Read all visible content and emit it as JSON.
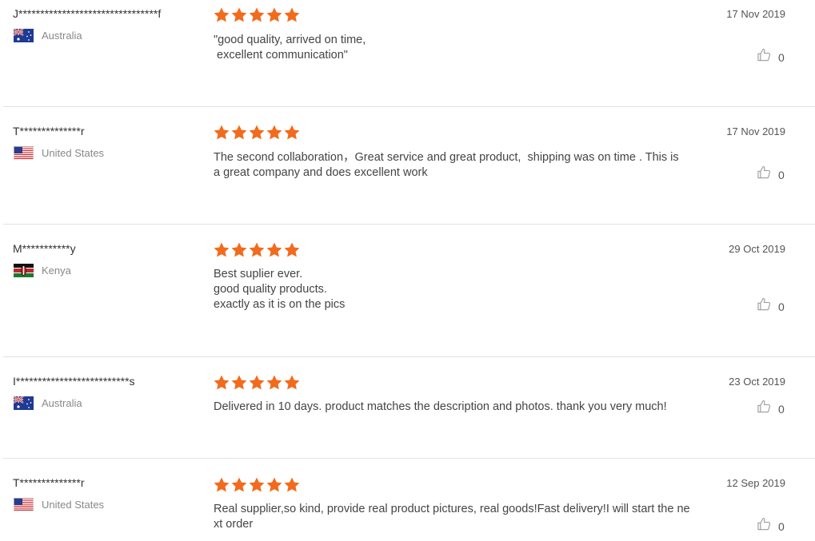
{
  "reviews": [
    {
      "name": "J********************************f",
      "country": "Australia",
      "flag": "australia-flag-icon",
      "rating": 5,
      "text_lines": [
        "\"good quality, arrived on time,",
        " excellent communication\""
      ],
      "date": "17 Nov 2019",
      "likes": "0"
    },
    {
      "name": "T**************r",
      "country": "United States",
      "flag": "us-flag-icon",
      "rating": 5,
      "text_lines": [
        "The second collaboration，Great service and great product,  shipping was on time . This is",
        "a great company and does excellent work"
      ],
      "date": "17 Nov 2019",
      "likes": "0"
    },
    {
      "name": "M***********y",
      "country": "Kenya",
      "flag": "kenya-flag-icon",
      "rating": 5,
      "text_lines": [
        "Best suplier ever.",
        "good quality products.",
        "exactly as it is on the pics"
      ],
      "date": "29 Oct 2019",
      "likes": "0"
    },
    {
      "name": "I**************************s",
      "country": "Australia",
      "flag": "australia-flag-icon",
      "rating": 5,
      "text_lines": [
        "Delivered in 10 days. product matches the description and photos. thank you very much!"
      ],
      "date": "23 Oct 2019",
      "likes": "0"
    },
    {
      "name": "T**************r",
      "country": "United States",
      "flag": "us-flag-icon",
      "rating": 5,
      "text_lines": [
        "Real supplier,so kind, provide real product pictures, real goods!Fast delivery!I will start the ne",
        "xt order"
      ],
      "date": "12 Sep 2019",
      "likes": "0"
    }
  ],
  "colors": {
    "star": "#f26b1d",
    "divider": "#e3e3e3",
    "meta_text": "#888888"
  }
}
